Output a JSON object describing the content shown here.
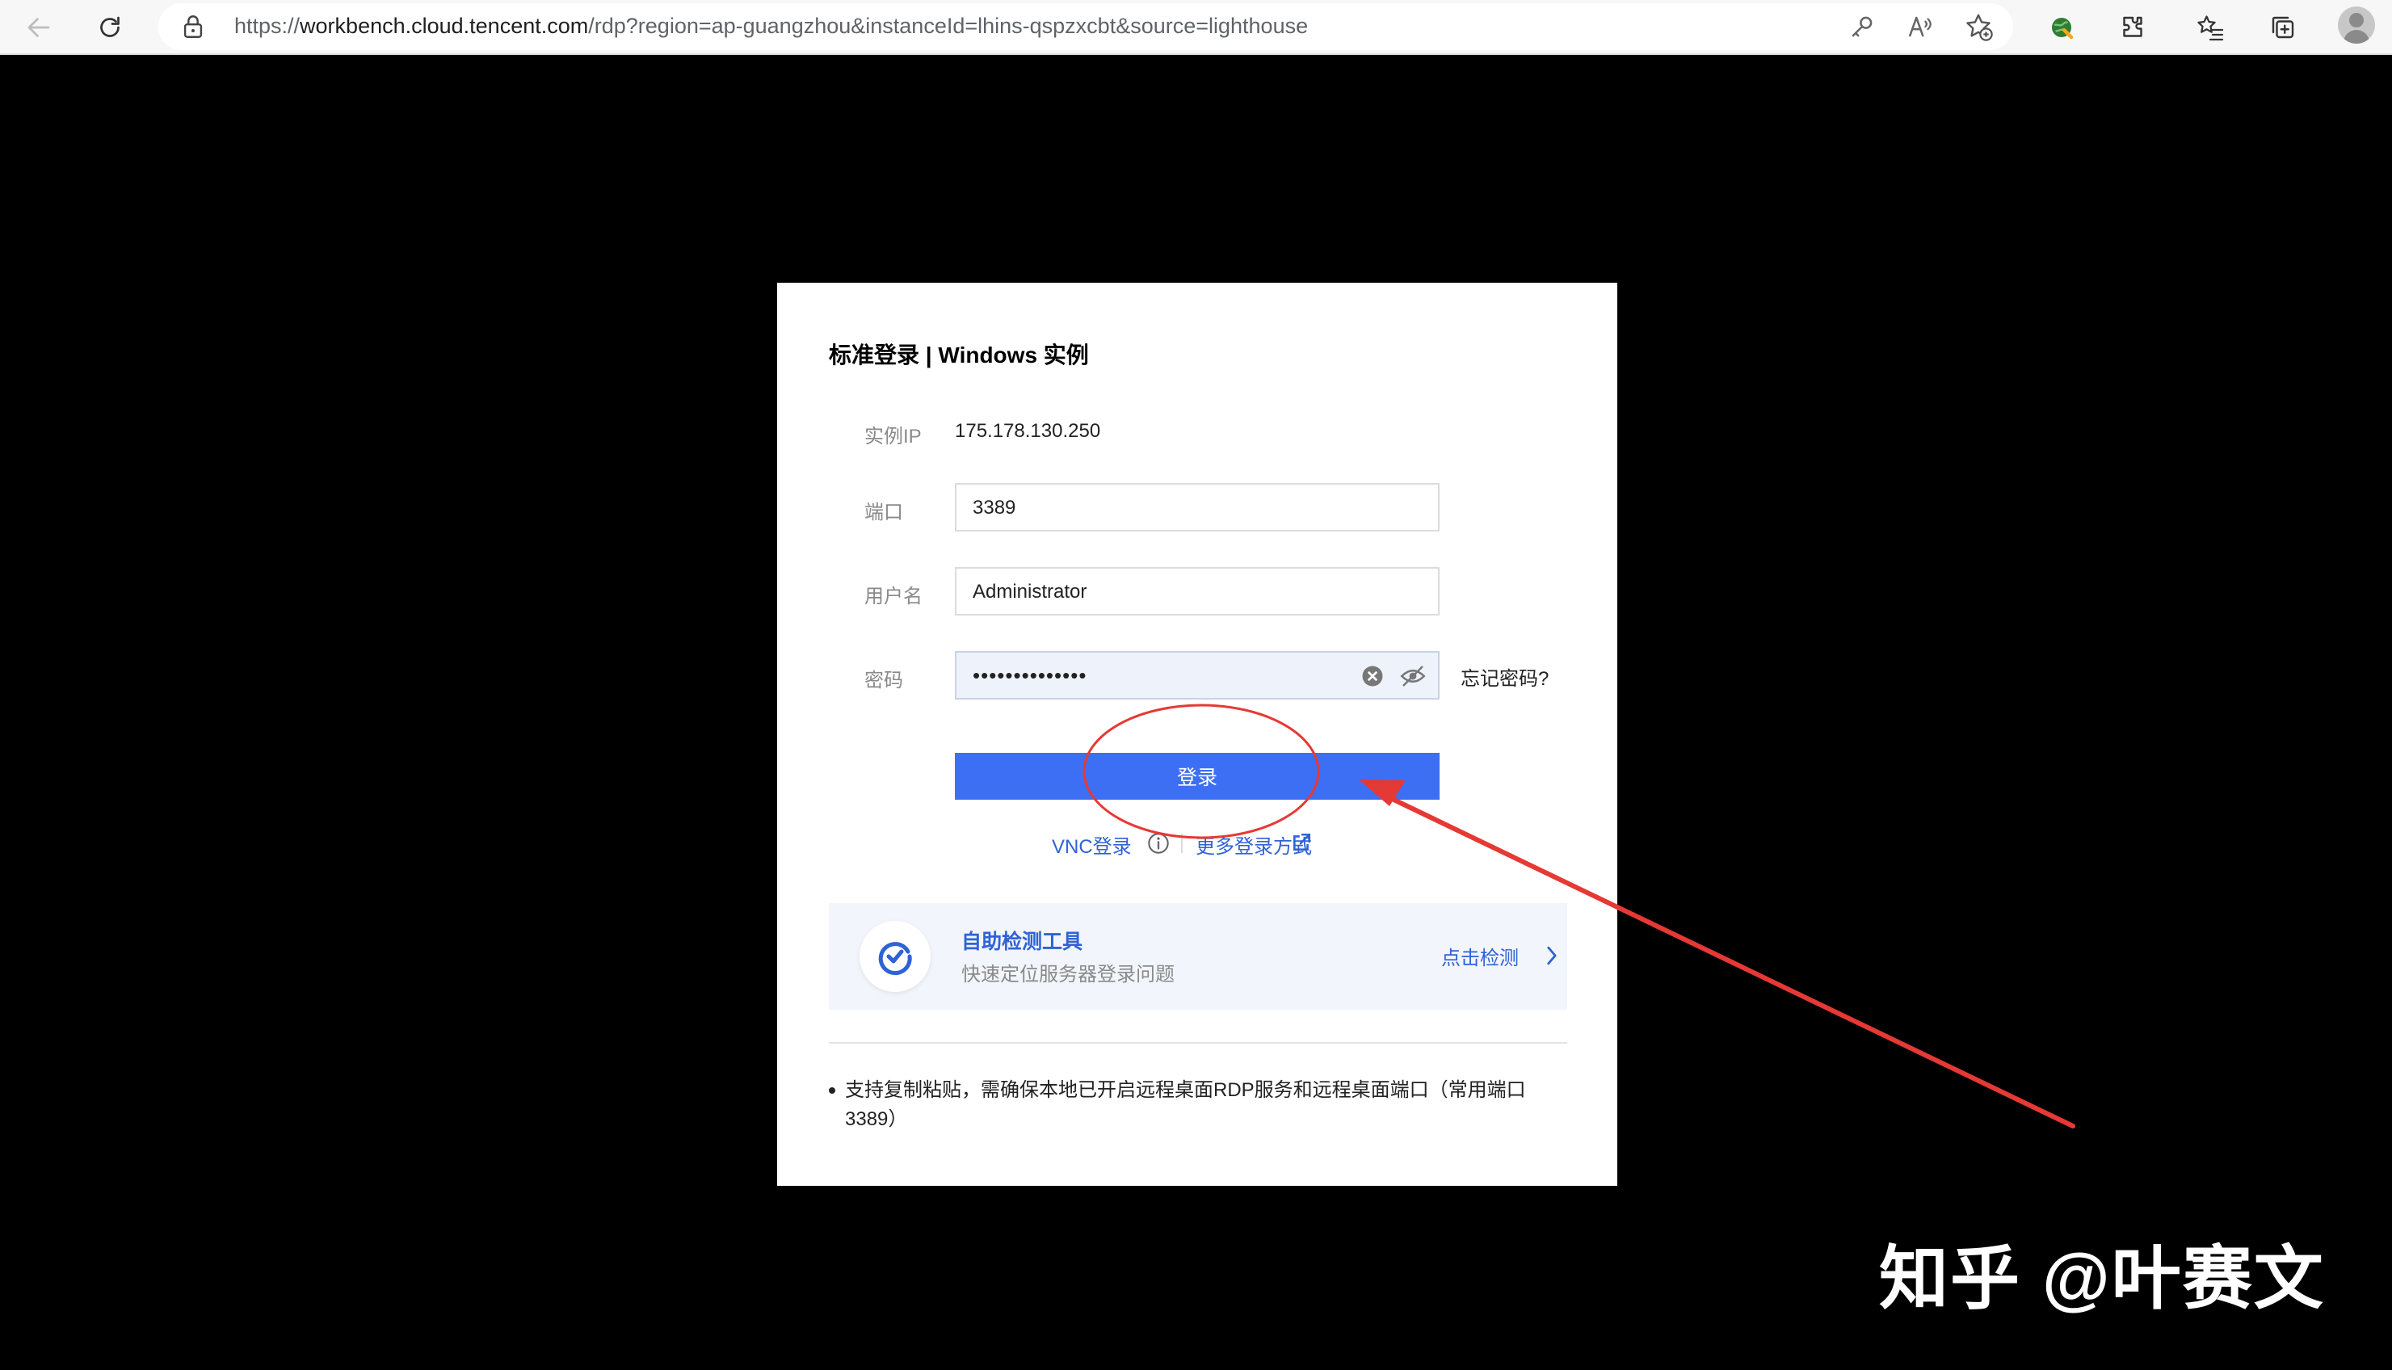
{
  "browser": {
    "url_prefix": "https://",
    "url_host": "workbench.cloud.tencent.com",
    "url_path": "/rdp?region=ap-guangzhou&instanceId=lhins-qspzxcbt&source=lighthouse"
  },
  "dialog": {
    "title": "标准登录 | Windows 实例",
    "ip_label": "实例IP",
    "ip_value": "175.178.130.250",
    "port_label": "端口",
    "port_value": "3389",
    "username_label": "用户名",
    "username_value": "Administrator",
    "password_label": "密码",
    "password_value": "••••••••••••••",
    "forgot_label": "忘记密码?",
    "login_label": "登录",
    "vnc_label": "VNC登录",
    "more_label": "更多登录方式",
    "tool_title": "自助检测工具",
    "tool_subtitle": "快速定位服务器登录问题",
    "tool_action": "点击检测",
    "note": "支持复制粘贴，需确保本地已开启远程桌面RDP服务和远程桌面端口（常用端口3389）"
  },
  "watermark": "知乎 @叶赛文",
  "colors": {
    "accent": "#3d6ff5",
    "link": "#2f62d6",
    "annotation": "#e53935"
  }
}
